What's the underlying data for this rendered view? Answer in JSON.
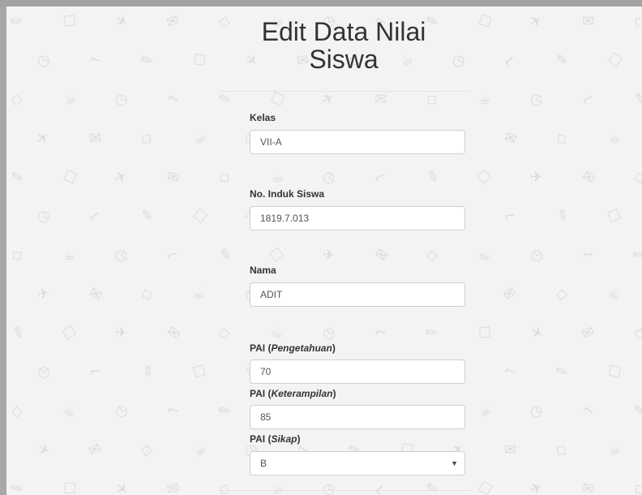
{
  "title_line1": "Edit Data Nilai",
  "title_line2": "Siswa",
  "fields": {
    "kelas": {
      "label": "Kelas",
      "value": "VII-A"
    },
    "nis": {
      "label": "No. Induk Siswa",
      "value": "1819.7.013"
    },
    "nama": {
      "label": "Nama",
      "value": "ADIT"
    },
    "pai_pengetahuan": {
      "label_prefix": "PAI (",
      "label_em": "Pengetahuan",
      "label_suffix": ")",
      "value": "70"
    },
    "pai_keterampilan": {
      "label_prefix": "PAI (",
      "label_em": "Keterampilan",
      "label_suffix": ")",
      "value": "85"
    },
    "pai_sikap": {
      "label_prefix": "PAI (",
      "label_em": "Sikap",
      "label_suffix": ")",
      "value": "B"
    }
  },
  "colors": {
    "panel_bg": "#f3f3f3",
    "pattern_icon": "#dcdcdc",
    "text": "#333333"
  }
}
